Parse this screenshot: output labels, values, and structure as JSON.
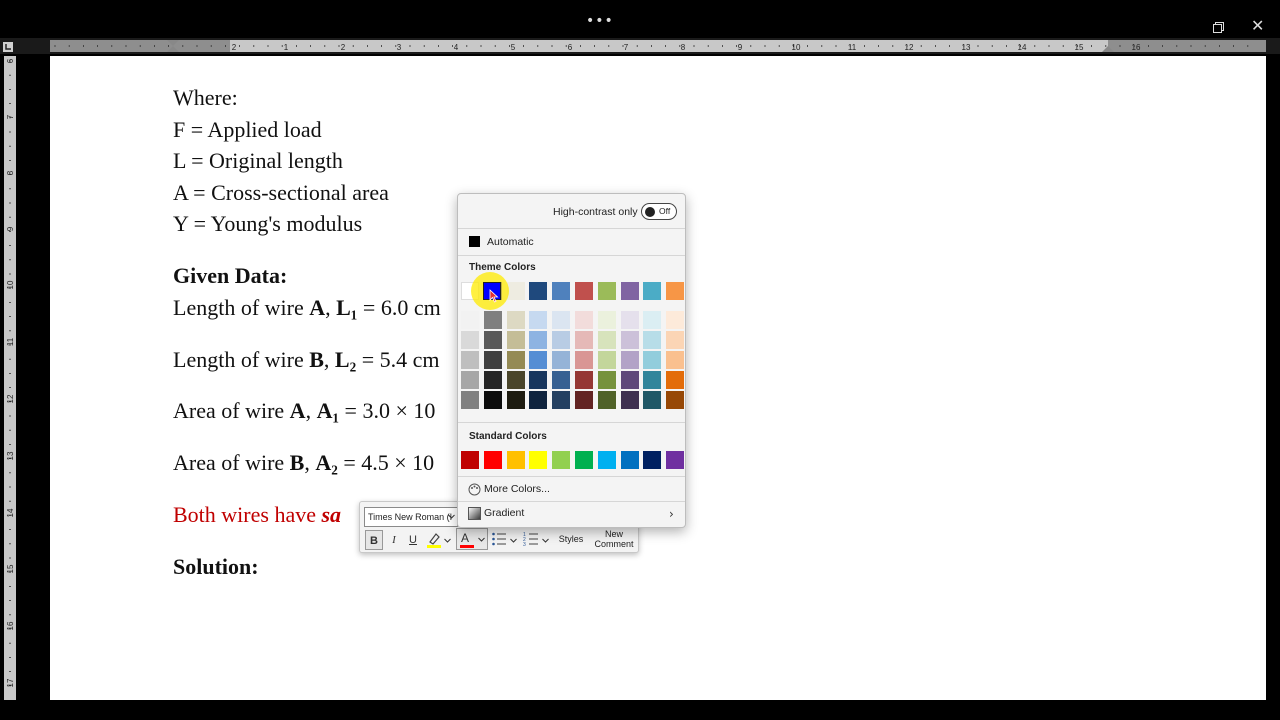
{
  "titlebar": {
    "more_icon": "ellipsis-icon",
    "dots": "•••",
    "close_glyph": "✕"
  },
  "ruler": {
    "h_numbers": [
      "2",
      "1",
      "1",
      "2",
      "3",
      "4",
      "5",
      "6",
      "7",
      "8",
      "9",
      "10",
      "11",
      "12",
      "13",
      "14",
      "15",
      "16"
    ],
    "v_numbers": [
      "6",
      "7",
      "8",
      "9",
      "10",
      "11",
      "12",
      "13",
      "14",
      "15",
      "16",
      "17"
    ],
    "corner_glyph": "L"
  },
  "document": {
    "lines": [
      {
        "text": "Where:"
      },
      {
        "text": "F = Applied load"
      },
      {
        "text": "L = Original length"
      },
      {
        "text": "A = Cross-sectional area"
      },
      {
        "text": "Y = Young's modulus"
      }
    ],
    "given_heading": "Given Data:",
    "data_lines": [
      {
        "pre": "Length of wire ",
        "b1": "A",
        "mid": ", ",
        "b2": "L₁",
        "post": " = 6.0 cm"
      },
      {
        "pre": "Length of wire ",
        "b1": "B",
        "mid": ", ",
        "b2": "L₂",
        "post": " = 5.4 cm"
      },
      {
        "pre": "Area of wire ",
        "b1": "A",
        "mid": ", ",
        "b2": "A₁",
        "post": " = 3.0 × 10"
      },
      {
        "pre": "Area of wire ",
        "b1": "B",
        "mid": ", ",
        "b2": "A₂",
        "post": " = 4.5 × 10"
      }
    ],
    "red_line_pre": "Both wires have ",
    "red_line_bold": "sa",
    "solution_heading": "Solution:",
    "red_color": "#c00000"
  },
  "mini_toolbar": {
    "font_name": "Times New Roman (I",
    "bold": "B",
    "italic": "I",
    "underline": "U",
    "font_color_letter": "A",
    "styles": "Styles",
    "new_comment_1": "New",
    "new_comment_2": "Comment"
  },
  "color_panel": {
    "high_contrast_label": "High-contrast only",
    "toggle_state": "Off",
    "automatic_label": "Automatic",
    "theme_title": "Theme Colors",
    "theme_colors": [
      "#ffffff",
      "#0000ff",
      "#eeece1",
      "#1f497d",
      "#4f81bd",
      "#c0504d",
      "#9bbb59",
      "#8064a2",
      "#4bacc6",
      "#f79646"
    ],
    "theme_shades": [
      [
        "#f2f2f2",
        "#d9d9d9",
        "#bfbfbf",
        "#a6a6a6",
        "#808080"
      ],
      [
        "#7f7f7f",
        "#595959",
        "#3f3f3f",
        "#262626",
        "#0d0d0d"
      ],
      [
        "#ddd9c3",
        "#c4bd97",
        "#948a54",
        "#4a452a",
        "#1d1b10"
      ],
      [
        "#c6d9f0",
        "#8db3e2",
        "#548dd4",
        "#17365d",
        "#0f243e"
      ],
      [
        "#dbe5f1",
        "#b8cce4",
        "#95b3d7",
        "#366092",
        "#244061"
      ],
      [
        "#f2dcdb",
        "#e5b9b7",
        "#d99694",
        "#953734",
        "#632423"
      ],
      [
        "#ebf1dd",
        "#d7e3bc",
        "#c3d69b",
        "#76923c",
        "#4f6128"
      ],
      [
        "#e5e0ec",
        "#ccc1d9",
        "#b2a2c7",
        "#5f497a",
        "#3f3151"
      ],
      [
        "#dbeef3",
        "#b7dde8",
        "#92cddc",
        "#31859b",
        "#205867"
      ],
      [
        "#fdeada",
        "#fbd5b5",
        "#fac08f",
        "#e36c09",
        "#974806"
      ]
    ],
    "standard_title": "Standard Colors",
    "standard_colors": [
      "#c00000",
      "#ff0000",
      "#ffc000",
      "#ffff00",
      "#92d050",
      "#00b050",
      "#00b0f0",
      "#0070c0",
      "#002060",
      "#7030a0"
    ],
    "more_colors_label": "More Colors...",
    "gradient_label": "Gradient",
    "chevron": "›",
    "selected_color": "#0000ff"
  }
}
